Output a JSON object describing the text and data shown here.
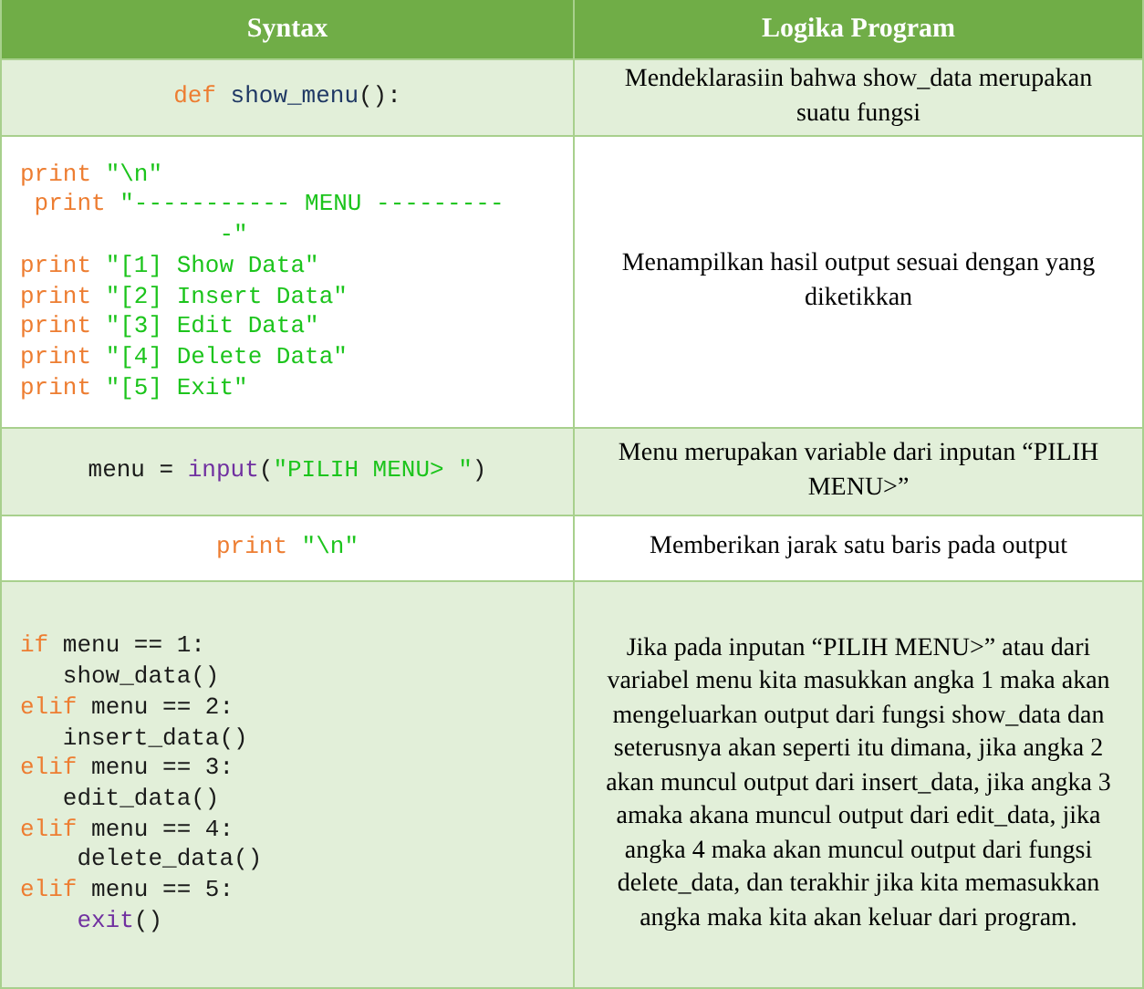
{
  "table": {
    "columns": [
      "Syntax",
      "Logika Program"
    ],
    "rows": [
      {
        "code": [
          [
            {
              "text": "def",
              "kind": "keyword"
            },
            {
              "text": " show_menu",
              "kind": "name"
            },
            {
              "text": "():",
              "kind": "plain"
            }
          ]
        ],
        "description": "Mendeklarasiin bahwa show_data merupakan suatu fungsi"
      },
      {
        "code": [
          [
            {
              "text": "print",
              "kind": "keyword"
            },
            {
              "text": " \"\\n\"",
              "kind": "string"
            }
          ],
          [
            {
              "text": " print",
              "kind": "keyword"
            },
            {
              "text": " \"----------- MENU ---------",
              "kind": "string"
            }
          ],
          [
            {
              "text": "              -\"",
              "kind": "string"
            }
          ],
          [
            {
              "text": "print",
              "kind": "keyword"
            },
            {
              "text": " \"[1] Show Data\"",
              "kind": "string"
            }
          ],
          [
            {
              "text": "print",
              "kind": "keyword"
            },
            {
              "text": " \"[2] Insert Data\"",
              "kind": "string"
            }
          ],
          [
            {
              "text": "print",
              "kind": "keyword"
            },
            {
              "text": " \"[3] Edit Data\"",
              "kind": "string"
            }
          ],
          [
            {
              "text": "print",
              "kind": "keyword"
            },
            {
              "text": " \"[4] Delete Data\"",
              "kind": "string"
            }
          ],
          [
            {
              "text": "print",
              "kind": "keyword"
            },
            {
              "text": " \"[5] Exit\"",
              "kind": "string"
            }
          ]
        ],
        "description": "Menampilkan hasil output sesuai dengan yang diketikkan"
      },
      {
        "code": [
          [
            {
              "text": "menu = ",
              "kind": "plain"
            },
            {
              "text": "input",
              "kind": "builtin"
            },
            {
              "text": "(",
              "kind": "plain"
            },
            {
              "text": "\"PILIH MENU> \"",
              "kind": "string"
            },
            {
              "text": ")",
              "kind": "plain"
            }
          ]
        ],
        "description": "Menu merupakan variable dari inputan “PILIH MENU>”"
      },
      {
        "code": [
          [
            {
              "text": "print",
              "kind": "keyword"
            },
            {
              "text": " \"\\n\"",
              "kind": "string"
            }
          ]
        ],
        "description": "Memberikan jarak satu baris pada output"
      },
      {
        "code": [
          [
            {
              "text": "if",
              "kind": "keyword"
            },
            {
              "text": " menu == 1:",
              "kind": "plain"
            }
          ],
          [
            {
              "text": "   show_data()",
              "kind": "plain"
            }
          ],
          [
            {
              "text": "elif",
              "kind": "keyword"
            },
            {
              "text": " menu == 2:",
              "kind": "plain"
            }
          ],
          [
            {
              "text": "   insert_data()",
              "kind": "plain"
            }
          ],
          [
            {
              "text": "elif",
              "kind": "keyword"
            },
            {
              "text": " menu == 3:",
              "kind": "plain"
            }
          ],
          [
            {
              "text": "   edit_data()",
              "kind": "plain"
            }
          ],
          [
            {
              "text": "elif",
              "kind": "keyword"
            },
            {
              "text": " menu == 4:",
              "kind": "plain"
            }
          ],
          [
            {
              "text": "    delete_data()",
              "kind": "plain"
            }
          ],
          [
            {
              "text": "elif",
              "kind": "keyword"
            },
            {
              "text": " menu == 5:",
              "kind": "plain"
            }
          ],
          [
            {
              "text": "    exit",
              "kind": "builtin"
            },
            {
              "text": "()",
              "kind": "plain"
            }
          ]
        ],
        "description": "Jika pada inputan “PILIH MENU>” atau dari variabel menu kita masukkan angka 1 maka akan mengeluarkan output dari fungsi show_data dan seterusnya akan seperti itu dimana, jika angka 2 akan muncul output dari insert_data, jika angka 3 amaka akana muncul output dari edit_data, jika angka 4 maka akan muncul output dari fungsi delete_data, dan terakhir jika kita memasukkan angka maka kita akan keluar dari program."
      }
    ]
  }
}
